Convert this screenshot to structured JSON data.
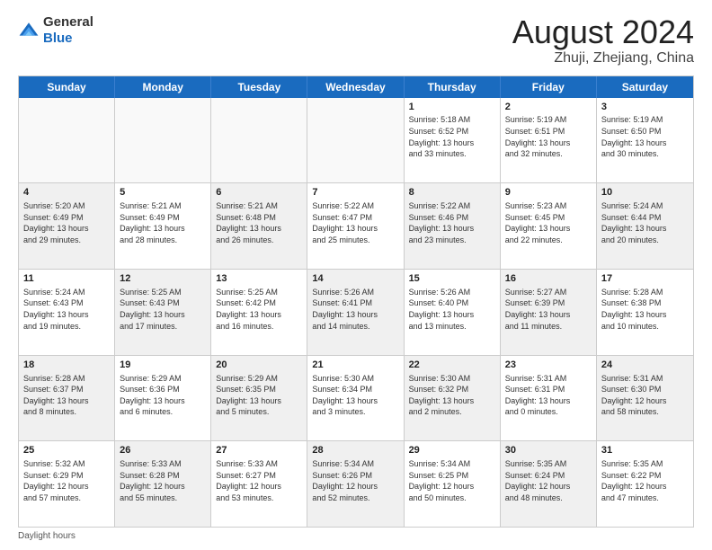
{
  "logo": {
    "general": "General",
    "blue": "Blue"
  },
  "header": {
    "title": "August 2024",
    "subtitle": "Zhuji, Zhejiang, China"
  },
  "days": [
    "Sunday",
    "Monday",
    "Tuesday",
    "Wednesday",
    "Thursday",
    "Friday",
    "Saturday"
  ],
  "weeks": [
    [
      {
        "day": "",
        "empty": true
      },
      {
        "day": "",
        "empty": true
      },
      {
        "day": "",
        "empty": true
      },
      {
        "day": "",
        "empty": true
      },
      {
        "day": "1",
        "lines": [
          "Sunrise: 5:18 AM",
          "Sunset: 6:52 PM",
          "Daylight: 13 hours",
          "and 33 minutes."
        ]
      },
      {
        "day": "2",
        "lines": [
          "Sunrise: 5:19 AM",
          "Sunset: 6:51 PM",
          "Daylight: 13 hours",
          "and 32 minutes."
        ]
      },
      {
        "day": "3",
        "lines": [
          "Sunrise: 5:19 AM",
          "Sunset: 6:50 PM",
          "Daylight: 13 hours",
          "and 30 minutes."
        ]
      }
    ],
    [
      {
        "day": "4",
        "shaded": true,
        "lines": [
          "Sunrise: 5:20 AM",
          "Sunset: 6:49 PM",
          "Daylight: 13 hours",
          "and 29 minutes."
        ]
      },
      {
        "day": "5",
        "lines": [
          "Sunrise: 5:21 AM",
          "Sunset: 6:49 PM",
          "Daylight: 13 hours",
          "and 28 minutes."
        ]
      },
      {
        "day": "6",
        "shaded": true,
        "lines": [
          "Sunrise: 5:21 AM",
          "Sunset: 6:48 PM",
          "Daylight: 13 hours",
          "and 26 minutes."
        ]
      },
      {
        "day": "7",
        "lines": [
          "Sunrise: 5:22 AM",
          "Sunset: 6:47 PM",
          "Daylight: 13 hours",
          "and 25 minutes."
        ]
      },
      {
        "day": "8",
        "shaded": true,
        "lines": [
          "Sunrise: 5:22 AM",
          "Sunset: 6:46 PM",
          "Daylight: 13 hours",
          "and 23 minutes."
        ]
      },
      {
        "day": "9",
        "lines": [
          "Sunrise: 5:23 AM",
          "Sunset: 6:45 PM",
          "Daylight: 13 hours",
          "and 22 minutes."
        ]
      },
      {
        "day": "10",
        "shaded": true,
        "lines": [
          "Sunrise: 5:24 AM",
          "Sunset: 6:44 PM",
          "Daylight: 13 hours",
          "and 20 minutes."
        ]
      }
    ],
    [
      {
        "day": "11",
        "lines": [
          "Sunrise: 5:24 AM",
          "Sunset: 6:43 PM",
          "Daylight: 13 hours",
          "and 19 minutes."
        ]
      },
      {
        "day": "12",
        "shaded": true,
        "lines": [
          "Sunrise: 5:25 AM",
          "Sunset: 6:43 PM",
          "Daylight: 13 hours",
          "and 17 minutes."
        ]
      },
      {
        "day": "13",
        "lines": [
          "Sunrise: 5:25 AM",
          "Sunset: 6:42 PM",
          "Daylight: 13 hours",
          "and 16 minutes."
        ]
      },
      {
        "day": "14",
        "shaded": true,
        "lines": [
          "Sunrise: 5:26 AM",
          "Sunset: 6:41 PM",
          "Daylight: 13 hours",
          "and 14 minutes."
        ]
      },
      {
        "day": "15",
        "lines": [
          "Sunrise: 5:26 AM",
          "Sunset: 6:40 PM",
          "Daylight: 13 hours",
          "and 13 minutes."
        ]
      },
      {
        "day": "16",
        "shaded": true,
        "lines": [
          "Sunrise: 5:27 AM",
          "Sunset: 6:39 PM",
          "Daylight: 13 hours",
          "and 11 minutes."
        ]
      },
      {
        "day": "17",
        "lines": [
          "Sunrise: 5:28 AM",
          "Sunset: 6:38 PM",
          "Daylight: 13 hours",
          "and 10 minutes."
        ]
      }
    ],
    [
      {
        "day": "18",
        "shaded": true,
        "lines": [
          "Sunrise: 5:28 AM",
          "Sunset: 6:37 PM",
          "Daylight: 13 hours",
          "and 8 minutes."
        ]
      },
      {
        "day": "19",
        "lines": [
          "Sunrise: 5:29 AM",
          "Sunset: 6:36 PM",
          "Daylight: 13 hours",
          "and 6 minutes."
        ]
      },
      {
        "day": "20",
        "shaded": true,
        "lines": [
          "Sunrise: 5:29 AM",
          "Sunset: 6:35 PM",
          "Daylight: 13 hours",
          "and 5 minutes."
        ]
      },
      {
        "day": "21",
        "lines": [
          "Sunrise: 5:30 AM",
          "Sunset: 6:34 PM",
          "Daylight: 13 hours",
          "and 3 minutes."
        ]
      },
      {
        "day": "22",
        "shaded": true,
        "lines": [
          "Sunrise: 5:30 AM",
          "Sunset: 6:32 PM",
          "Daylight: 13 hours",
          "and 2 minutes."
        ]
      },
      {
        "day": "23",
        "lines": [
          "Sunrise: 5:31 AM",
          "Sunset: 6:31 PM",
          "Daylight: 13 hours",
          "and 0 minutes."
        ]
      },
      {
        "day": "24",
        "shaded": true,
        "lines": [
          "Sunrise: 5:31 AM",
          "Sunset: 6:30 PM",
          "Daylight: 12 hours",
          "and 58 minutes."
        ]
      }
    ],
    [
      {
        "day": "25",
        "lines": [
          "Sunrise: 5:32 AM",
          "Sunset: 6:29 PM",
          "Daylight: 12 hours",
          "and 57 minutes."
        ]
      },
      {
        "day": "26",
        "shaded": true,
        "lines": [
          "Sunrise: 5:33 AM",
          "Sunset: 6:28 PM",
          "Daylight: 12 hours",
          "and 55 minutes."
        ]
      },
      {
        "day": "27",
        "lines": [
          "Sunrise: 5:33 AM",
          "Sunset: 6:27 PM",
          "Daylight: 12 hours",
          "and 53 minutes."
        ]
      },
      {
        "day": "28",
        "shaded": true,
        "lines": [
          "Sunrise: 5:34 AM",
          "Sunset: 6:26 PM",
          "Daylight: 12 hours",
          "and 52 minutes."
        ]
      },
      {
        "day": "29",
        "lines": [
          "Sunrise: 5:34 AM",
          "Sunset: 6:25 PM",
          "Daylight: 12 hours",
          "and 50 minutes."
        ]
      },
      {
        "day": "30",
        "shaded": true,
        "lines": [
          "Sunrise: 5:35 AM",
          "Sunset: 6:24 PM",
          "Daylight: 12 hours",
          "and 48 minutes."
        ]
      },
      {
        "day": "31",
        "lines": [
          "Sunrise: 5:35 AM",
          "Sunset: 6:22 PM",
          "Daylight: 12 hours",
          "and 47 minutes."
        ]
      }
    ]
  ],
  "footer": {
    "daylight_label": "Daylight hours"
  }
}
